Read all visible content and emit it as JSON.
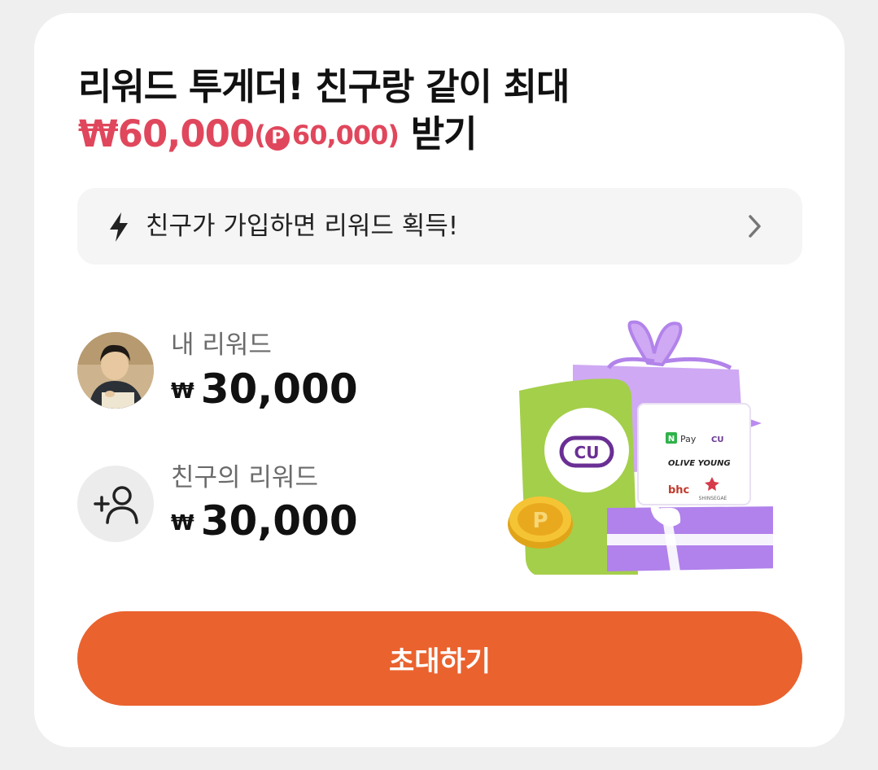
{
  "title": {
    "line1": "리워드 투게더! 친구랑 같이 최대",
    "amount_won": "₩60,000",
    "amount_point_badge": "P",
    "amount_point": "60,000",
    "paren_open": "(",
    "paren_close": ")",
    "suffix": " 받기"
  },
  "banner": {
    "text": "친구가 가입하면 리워드 획득!",
    "icon": "bolt-icon",
    "chevron": "chevron-right-icon"
  },
  "my_reward": {
    "label": "내 리워드",
    "currency": "₩",
    "amount": "30,000"
  },
  "friend_reward": {
    "label": "친구의 리워드",
    "currency": "₩",
    "amount": "30,000"
  },
  "illustration": {
    "cu_logo": "CU",
    "npay_badge": "N",
    "npay_text": "Pay",
    "brand_cu": "CU",
    "olive_young": "OLIVE YOUNG",
    "bhc": "bhc",
    "shinsegae": "SHINSEGAE",
    "coin_letter": "P"
  },
  "invite_button": {
    "label": "초대하기"
  },
  "colors": {
    "accent_red": "#e0475c",
    "button_orange": "#ea622e",
    "banner_bg": "#f5f5f5"
  }
}
